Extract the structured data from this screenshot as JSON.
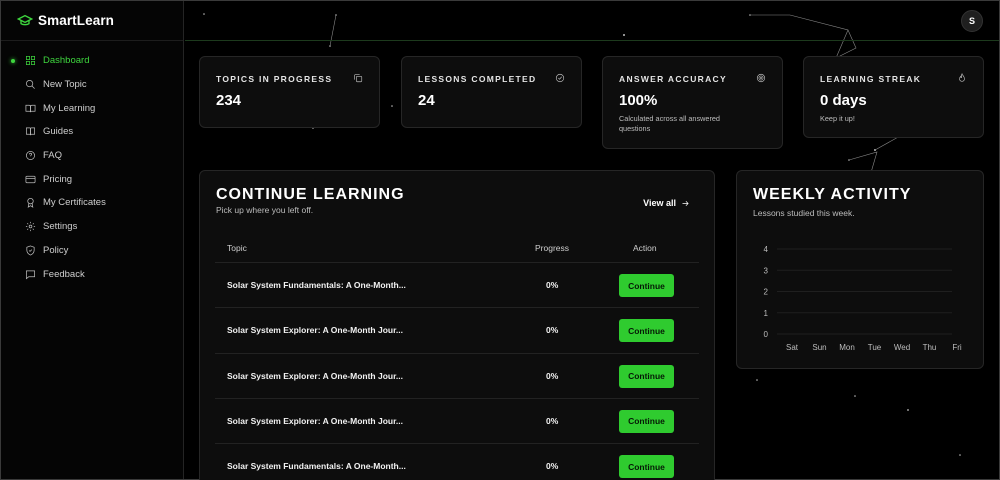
{
  "brand": {
    "name": "SmartLearn"
  },
  "user": {
    "initial": "S"
  },
  "sidebar": {
    "items": [
      {
        "label": "Dashboard",
        "icon": "dashboard-icon",
        "active": true
      },
      {
        "label": "New Topic",
        "icon": "search-icon"
      },
      {
        "label": "My Learning",
        "icon": "book-open-icon"
      },
      {
        "label": "Guides",
        "icon": "book-icon"
      },
      {
        "label": "FAQ",
        "icon": "help-circle-icon"
      },
      {
        "label": "Pricing",
        "icon": "credit-card-icon"
      },
      {
        "label": "My Certificates",
        "icon": "certificate-icon"
      },
      {
        "label": "Settings",
        "icon": "gear-icon"
      },
      {
        "label": "Policy",
        "icon": "shield-icon"
      },
      {
        "label": "Feedback",
        "icon": "message-icon"
      }
    ]
  },
  "stats": [
    {
      "label": "TOPICS IN PROGRESS",
      "value": "234",
      "sub": "",
      "icon": "copy-icon"
    },
    {
      "label": "LESSONS COMPLETED",
      "value": "24",
      "sub": "",
      "icon": "check-circle-icon"
    },
    {
      "label": "ANSWER ACCURACY",
      "value": "100%",
      "sub": "Calculated across all answered questions",
      "icon": "target-icon"
    },
    {
      "label": "LEARNING STREAK",
      "value": "0 days",
      "sub": "Keep it up!",
      "icon": "flame-icon"
    }
  ],
  "continue": {
    "title": "CONTINUE LEARNING",
    "subtitle": "Pick up where you left off.",
    "view_all": "View all",
    "columns": {
      "topic": "Topic",
      "progress": "Progress",
      "action": "Action"
    },
    "rows": [
      {
        "topic": "Solar System Fundamentals: A One-Month...",
        "progress": "0%",
        "action": "Continue"
      },
      {
        "topic": "Solar System Explorer: A One-Month Jour...",
        "progress": "0%",
        "action": "Continue"
      },
      {
        "topic": "Solar System Explorer: A One-Month Jour...",
        "progress": "0%",
        "action": "Continue"
      },
      {
        "topic": "Solar System Explorer: A One-Month Jour...",
        "progress": "0%",
        "action": "Continue"
      },
      {
        "topic": "Solar System Fundamentals: A One-Month...",
        "progress": "0%",
        "action": "Continue"
      }
    ]
  },
  "weekly": {
    "title": "WEEKLY ACTIVITY",
    "subtitle": "Lessons studied this week."
  },
  "colors": {
    "accent": "#3ed63e",
    "button": "#2fcb2f",
    "background": "#000000",
    "card": "#0d0d0d"
  },
  "chart_data": {
    "type": "bar",
    "title": "WEEKLY ACTIVITY",
    "categories": [
      "Sat",
      "Sun",
      "Mon",
      "Tue",
      "Wed",
      "Thu",
      "Fri"
    ],
    "values": [
      0,
      0,
      0,
      0,
      0,
      0,
      0
    ],
    "yticks": [
      0,
      1,
      2,
      3,
      4
    ],
    "ylim": [
      0,
      4
    ],
    "grid": true,
    "legend": "none"
  }
}
